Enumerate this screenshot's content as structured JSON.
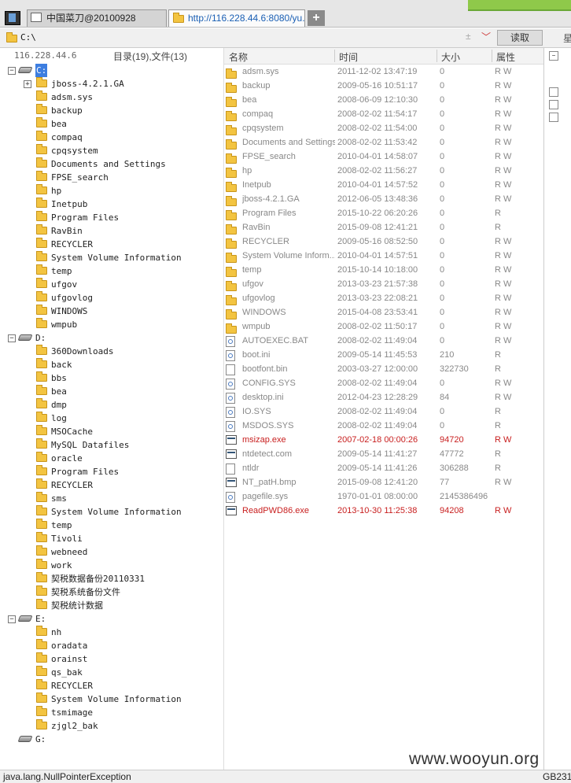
{
  "tabs": [
    {
      "label": "中国菜刀@20100928",
      "active": false
    },
    {
      "label": "http://116.228.44.6:8080/yu...",
      "active": true
    }
  ],
  "new_tab_label": "+",
  "path": {
    "value": "C:\\",
    "read_button": "读取",
    "right_label": "星"
  },
  "left": {
    "ip": "116.228.44.6",
    "stat": "目录(19),文件(13)",
    "tree": [
      {
        "level": 0,
        "type": "drive",
        "label": "C:",
        "expander": "−",
        "selected": true
      },
      {
        "level": 1,
        "type": "folder",
        "label": "jboss-4.2.1.GA",
        "expander": "+"
      },
      {
        "level": 1,
        "type": "folder",
        "label": "adsm.sys"
      },
      {
        "level": 1,
        "type": "folder",
        "label": "backup"
      },
      {
        "level": 1,
        "type": "folder",
        "label": "bea"
      },
      {
        "level": 1,
        "type": "folder",
        "label": "compaq"
      },
      {
        "level": 1,
        "type": "folder",
        "label": "cpqsystem"
      },
      {
        "level": 1,
        "type": "folder",
        "label": "Documents and Settings"
      },
      {
        "level": 1,
        "type": "folder",
        "label": "FPSE_search"
      },
      {
        "level": 1,
        "type": "folder",
        "label": "hp"
      },
      {
        "level": 1,
        "type": "folder",
        "label": "Inetpub"
      },
      {
        "level": 1,
        "type": "folder",
        "label": "Program Files"
      },
      {
        "level": 1,
        "type": "folder",
        "label": "RavBin"
      },
      {
        "level": 1,
        "type": "folder",
        "label": "RECYCLER"
      },
      {
        "level": 1,
        "type": "folder",
        "label": "System Volume Information"
      },
      {
        "level": 1,
        "type": "folder",
        "label": "temp"
      },
      {
        "level": 1,
        "type": "folder",
        "label": "ufgov"
      },
      {
        "level": 1,
        "type": "folder",
        "label": "ufgovlog"
      },
      {
        "level": 1,
        "type": "folder",
        "label": "WINDOWS"
      },
      {
        "level": 1,
        "type": "folder",
        "label": "wmpub"
      },
      {
        "level": 0,
        "type": "drive",
        "label": "D:",
        "expander": "−"
      },
      {
        "level": 1,
        "type": "folder",
        "label": "360Downloads"
      },
      {
        "level": 1,
        "type": "folder",
        "label": "back"
      },
      {
        "level": 1,
        "type": "folder",
        "label": "bbs"
      },
      {
        "level": 1,
        "type": "folder",
        "label": "bea"
      },
      {
        "level": 1,
        "type": "folder",
        "label": "dmp"
      },
      {
        "level": 1,
        "type": "folder",
        "label": "log"
      },
      {
        "level": 1,
        "type": "folder",
        "label": "MSOCache"
      },
      {
        "level": 1,
        "type": "folder",
        "label": "MySQL Datafiles"
      },
      {
        "level": 1,
        "type": "folder",
        "label": "oracle"
      },
      {
        "level": 1,
        "type": "folder",
        "label": "Program Files"
      },
      {
        "level": 1,
        "type": "folder",
        "label": "RECYCLER"
      },
      {
        "level": 1,
        "type": "folder",
        "label": "sms"
      },
      {
        "level": 1,
        "type": "folder",
        "label": "System Volume Information"
      },
      {
        "level": 1,
        "type": "folder",
        "label": "temp"
      },
      {
        "level": 1,
        "type": "folder",
        "label": "Tivoli"
      },
      {
        "level": 1,
        "type": "folder",
        "label": "webneed"
      },
      {
        "level": 1,
        "type": "folder",
        "label": "work"
      },
      {
        "level": 1,
        "type": "folder",
        "label": "契税数据备份20110331"
      },
      {
        "level": 1,
        "type": "folder",
        "label": "契税系统备份文件"
      },
      {
        "level": 1,
        "type": "folder",
        "label": "契税统计数据"
      },
      {
        "level": 0,
        "type": "drive",
        "label": "E:",
        "expander": "−"
      },
      {
        "level": 1,
        "type": "folder",
        "label": "nh"
      },
      {
        "level": 1,
        "type": "folder",
        "label": "oradata"
      },
      {
        "level": 1,
        "type": "folder",
        "label": "orainst"
      },
      {
        "level": 1,
        "type": "folder",
        "label": "qs_bak"
      },
      {
        "level": 1,
        "type": "folder",
        "label": "RECYCLER"
      },
      {
        "level": 1,
        "type": "folder",
        "label": "System Volume Information"
      },
      {
        "level": 1,
        "type": "folder",
        "label": "tsmimage"
      },
      {
        "level": 1,
        "type": "folder",
        "label": "zjgl2_bak"
      },
      {
        "level": 0,
        "type": "drive",
        "label": "G:"
      }
    ]
  },
  "columns": {
    "name": "名称",
    "time": "时间",
    "size": "大小",
    "attr": "属性"
  },
  "files": [
    {
      "icon": "folder",
      "name": "adsm.sys",
      "time": "2011-12-02 13:47:19",
      "size": "0",
      "attr": "R W"
    },
    {
      "icon": "folder",
      "name": "backup",
      "time": "2009-05-16 10:51:17",
      "size": "0",
      "attr": "R W"
    },
    {
      "icon": "folder",
      "name": "bea",
      "time": "2008-06-09 12:10:30",
      "size": "0",
      "attr": "R W"
    },
    {
      "icon": "folder",
      "name": "compaq",
      "time": "2008-02-02 11:54:17",
      "size": "0",
      "attr": "R W"
    },
    {
      "icon": "folder",
      "name": "cpqsystem",
      "time": "2008-02-02 11:54:00",
      "size": "0",
      "attr": "R W"
    },
    {
      "icon": "folder",
      "name": "Documents and Settings",
      "time": "2008-02-02 11:53:42",
      "size": "0",
      "attr": "R W"
    },
    {
      "icon": "folder",
      "name": "FPSE_search",
      "time": "2010-04-01 14:58:07",
      "size": "0",
      "attr": "R W"
    },
    {
      "icon": "folder",
      "name": "hp",
      "time": "2008-02-02 11:56:27",
      "size": "0",
      "attr": "R W"
    },
    {
      "icon": "folder",
      "name": "Inetpub",
      "time": "2010-04-01 14:57:52",
      "size": "0",
      "attr": "R W"
    },
    {
      "icon": "folder",
      "name": "jboss-4.2.1.GA",
      "time": "2012-06-05 13:48:36",
      "size": "0",
      "attr": "R W"
    },
    {
      "icon": "folder",
      "name": "Program Files",
      "time": "2015-10-22 06:20:26",
      "size": "0",
      "attr": "R"
    },
    {
      "icon": "folder",
      "name": "RavBin",
      "time": "2015-09-08 12:41:21",
      "size": "0",
      "attr": "R"
    },
    {
      "icon": "folder",
      "name": "RECYCLER",
      "time": "2009-05-16 08:52:50",
      "size": "0",
      "attr": "R W"
    },
    {
      "icon": "folder",
      "name": "System Volume Inform...",
      "time": "2010-04-01 14:57:51",
      "size": "0",
      "attr": "R W"
    },
    {
      "icon": "folder",
      "name": "temp",
      "time": "2015-10-14 10:18:00",
      "size": "0",
      "attr": "R W"
    },
    {
      "icon": "folder",
      "name": "ufgov",
      "time": "2013-03-23 21:57:38",
      "size": "0",
      "attr": "R W"
    },
    {
      "icon": "folder",
      "name": "ufgovlog",
      "time": "2013-03-23 22:08:21",
      "size": "0",
      "attr": "R W"
    },
    {
      "icon": "folder",
      "name": "WINDOWS",
      "time": "2015-04-08 23:53:41",
      "size": "0",
      "attr": "R W"
    },
    {
      "icon": "folder",
      "name": "wmpub",
      "time": "2008-02-02 11:50:17",
      "size": "0",
      "attr": "R W"
    },
    {
      "icon": "sys",
      "name": "AUTOEXEC.BAT",
      "time": "2008-02-02 11:49:04",
      "size": "0",
      "attr": "R W"
    },
    {
      "icon": "sys",
      "name": "boot.ini",
      "time": "2009-05-14 11:45:53",
      "size": "210",
      "attr": "R"
    },
    {
      "icon": "file",
      "name": "bootfont.bin",
      "time": "2003-03-27 12:00:00",
      "size": "322730",
      "attr": "R"
    },
    {
      "icon": "sys",
      "name": "CONFIG.SYS",
      "time": "2008-02-02 11:49:04",
      "size": "0",
      "attr": "R W"
    },
    {
      "icon": "sys",
      "name": "desktop.ini",
      "time": "2012-04-23 12:28:29",
      "size": "84",
      "attr": "R W"
    },
    {
      "icon": "sys",
      "name": "IO.SYS",
      "time": "2008-02-02 11:49:04",
      "size": "0",
      "attr": "R"
    },
    {
      "icon": "sys",
      "name": "MSDOS.SYS",
      "time": "2008-02-02 11:49:04",
      "size": "0",
      "attr": "R"
    },
    {
      "icon": "exe",
      "name": "msizap.exe",
      "time": "2007-02-18 00:00:26",
      "size": "94720",
      "attr": "R W",
      "highlight": true
    },
    {
      "icon": "exe",
      "name": "ntdetect.com",
      "time": "2009-05-14 11:41:27",
      "size": "47772",
      "attr": "R"
    },
    {
      "icon": "file",
      "name": "ntldr",
      "time": "2009-05-14 11:41:26",
      "size": "306288",
      "attr": "R"
    },
    {
      "icon": "exe",
      "name": "NT_patH.bmp",
      "time": "2015-09-08 12:41:20",
      "size": "77",
      "attr": "R W"
    },
    {
      "icon": "sys",
      "name": "pagefile.sys",
      "time": "1970-01-01 08:00:00",
      "size": "2145386496",
      "attr": ""
    },
    {
      "icon": "exe",
      "name": "ReadPWD86.exe",
      "time": "2013-10-30 11:25:38",
      "size": "94208",
      "attr": "R W",
      "highlight": true
    }
  ],
  "status": {
    "message": "java.lang.NullPointerException",
    "encoding": "GB231"
  },
  "watermark": "www.wooyun.org",
  "colors": {
    "highlight": "#c81e1e",
    "selected": "#3d7ee0",
    "folder": "#f3c441"
  }
}
